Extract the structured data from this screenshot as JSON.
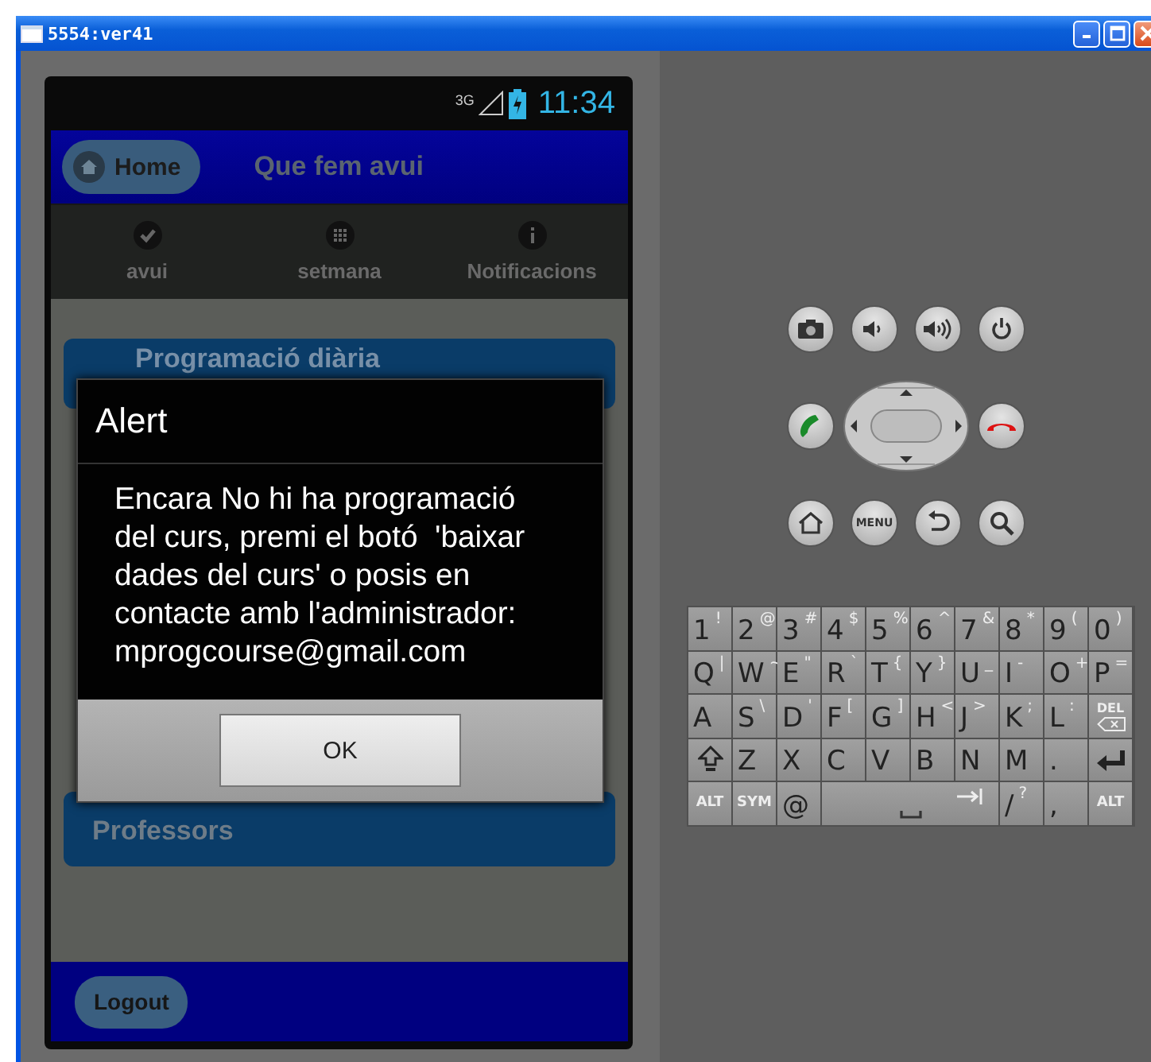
{
  "window": {
    "title": "5554:ver41"
  },
  "status_bar": {
    "network": "3G",
    "time": "11:34"
  },
  "action_bar": {
    "home_button": "Home",
    "title": "Que fem avui"
  },
  "tabs": [
    {
      "kind": "check",
      "label": "avui",
      "selected": false
    },
    {
      "kind": "grid",
      "label": "setmana",
      "selected": false
    },
    {
      "kind": "info",
      "label": "Notificacions",
      "selected": false
    }
  ],
  "list": [
    {
      "title": "Programació diària"
    },
    {
      "title": "Professors"
    }
  ],
  "dialog": {
    "title": "Alert",
    "message": "Encara No hi ha programació del curs, premi el botó  'baixar dades del curs' o posis en contacte amb l'administrador: mprogcourse@gmail.com",
    "button": "OK"
  },
  "bottom_bar": {
    "logout_button": "Logout"
  },
  "control_pad": {
    "menu_label": "MENU"
  },
  "keyboard": {
    "rows": [
      [
        {
          "kind": "char",
          "main": "1",
          "alt": "!"
        },
        {
          "kind": "char",
          "main": "2",
          "alt": "@"
        },
        {
          "kind": "char",
          "main": "3",
          "alt": "#"
        },
        {
          "kind": "char",
          "main": "4",
          "alt": "$"
        },
        {
          "kind": "char",
          "main": "5",
          "alt": "%"
        },
        {
          "kind": "char",
          "main": "6",
          "alt": "^"
        },
        {
          "kind": "char",
          "main": "7",
          "alt": "&"
        },
        {
          "kind": "char",
          "main": "8",
          "alt": "*"
        },
        {
          "kind": "char",
          "main": "9",
          "alt": "("
        },
        {
          "kind": "char",
          "main": "0",
          "alt": ")"
        }
      ],
      [
        {
          "kind": "char",
          "main": "Q",
          "alt": "|"
        },
        {
          "kind": "char",
          "main": "W",
          "alt": "~"
        },
        {
          "kind": "char",
          "main": "E",
          "alt": "\""
        },
        {
          "kind": "char",
          "main": "R",
          "alt": "`"
        },
        {
          "kind": "char",
          "main": "T",
          "alt": "{"
        },
        {
          "kind": "char",
          "main": "Y",
          "alt": "}"
        },
        {
          "kind": "char",
          "main": "U",
          "alt": "_"
        },
        {
          "kind": "char",
          "main": "I",
          "alt": "-"
        },
        {
          "kind": "char",
          "main": "O",
          "alt": "+"
        },
        {
          "kind": "char",
          "main": "P",
          "alt": "="
        }
      ],
      [
        {
          "kind": "char",
          "main": "A"
        },
        {
          "kind": "char",
          "main": "S",
          "alt": "\\"
        },
        {
          "kind": "char",
          "main": "D",
          "alt": "'"
        },
        {
          "kind": "char",
          "main": "F",
          "alt": "["
        },
        {
          "kind": "char",
          "main": "G",
          "alt": "]"
        },
        {
          "kind": "char",
          "main": "H",
          "alt": "<"
        },
        {
          "kind": "char",
          "main": "J",
          "alt": ">"
        },
        {
          "kind": "char",
          "main": "K",
          "alt": ";"
        },
        {
          "kind": "char",
          "main": "L",
          "alt": ":"
        },
        {
          "kind": "del",
          "main": "DEL"
        }
      ],
      [
        {
          "kind": "shift"
        },
        {
          "kind": "char",
          "main": "Z"
        },
        {
          "kind": "char",
          "main": "X"
        },
        {
          "kind": "char",
          "main": "C"
        },
        {
          "kind": "char",
          "main": "V"
        },
        {
          "kind": "char",
          "main": "B"
        },
        {
          "kind": "char",
          "main": "N"
        },
        {
          "kind": "char",
          "main": "M"
        },
        {
          "kind": "char",
          "main": "."
        },
        {
          "kind": "enter"
        }
      ]
    ],
    "bottom_row": [
      {
        "kind": "mod",
        "main": "ALT"
      },
      {
        "kind": "mod",
        "main": "SYM"
      },
      {
        "kind": "char",
        "main": "@"
      },
      {
        "kind": "space"
      },
      {
        "kind": "char",
        "main": "/",
        "alt": "?"
      },
      {
        "kind": "char",
        "main": ","
      },
      {
        "kind": "mod",
        "main": "ALT"
      }
    ]
  }
}
